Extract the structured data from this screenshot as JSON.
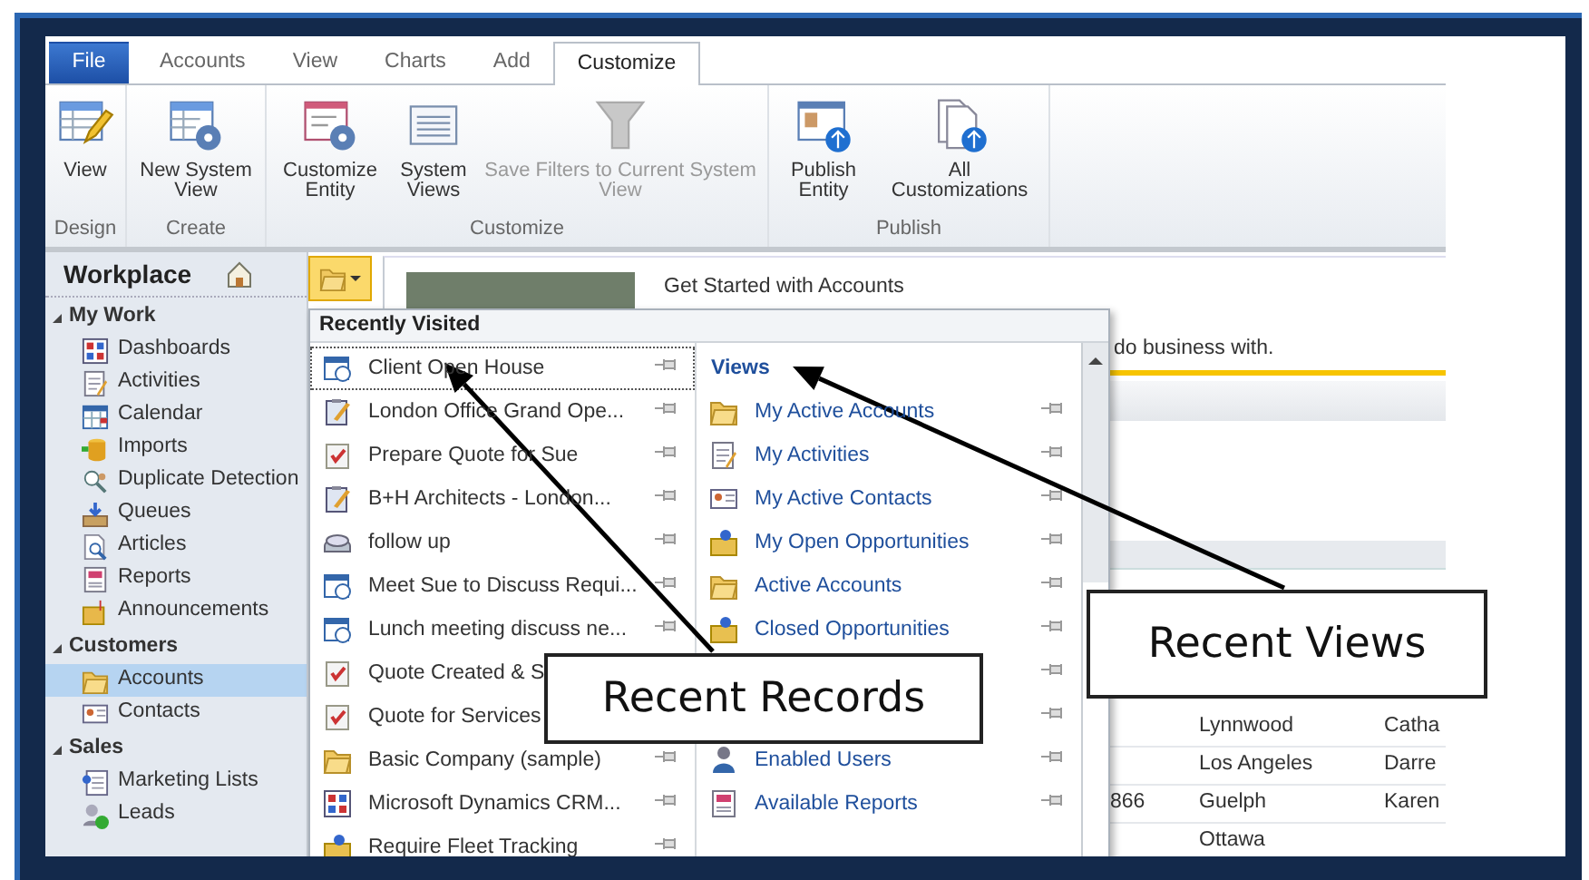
{
  "tabs": [
    {
      "label": "File",
      "kind": "file",
      "selected": false
    },
    {
      "label": "Accounts",
      "kind": "tab",
      "selected": false
    },
    {
      "label": "View",
      "kind": "tab",
      "selected": false
    },
    {
      "label": "Charts",
      "kind": "tab",
      "selected": false
    },
    {
      "label": "Add",
      "kind": "tab",
      "selected": false
    },
    {
      "label": "Customize",
      "kind": "tab",
      "selected": true
    }
  ],
  "ribbon": {
    "groups": [
      {
        "label": "Design",
        "buttons": [
          {
            "label": "View",
            "disabled": false
          }
        ]
      },
      {
        "label": "Create",
        "buttons": [
          {
            "label": "New System View",
            "disabled": false
          }
        ]
      },
      {
        "label": "Customize",
        "buttons": [
          {
            "label": "Customize Entity",
            "disabled": false
          },
          {
            "label": "System Views",
            "disabled": false
          },
          {
            "label": "Save Filters to Current System View",
            "disabled": true
          }
        ]
      },
      {
        "label": "Publish",
        "buttons": [
          {
            "label": "Publish Entity",
            "disabled": false
          },
          {
            "label": "All Customizations",
            "disabled": false
          }
        ]
      }
    ]
  },
  "nav": {
    "title": "Workplace",
    "sections": [
      {
        "label": "My Work",
        "expanded": true,
        "items": [
          {
            "label": "Dashboards",
            "selected": false
          },
          {
            "label": "Activities",
            "selected": false
          },
          {
            "label": "Calendar",
            "selected": false
          },
          {
            "label": "Imports",
            "selected": false
          },
          {
            "label": "Duplicate Detection",
            "selected": false
          },
          {
            "label": "Queues",
            "selected": false
          },
          {
            "label": "Articles",
            "selected": false
          },
          {
            "label": "Reports",
            "selected": false
          },
          {
            "label": "Announcements",
            "selected": false
          }
        ]
      },
      {
        "label": "Customers",
        "expanded": true,
        "items": [
          {
            "label": "Accounts",
            "selected": true
          },
          {
            "label": "Contacts",
            "selected": false
          }
        ]
      },
      {
        "label": "Sales",
        "expanded": true,
        "items": [
          {
            "label": "Marketing Lists",
            "selected": false
          },
          {
            "label": "Leads",
            "selected": false
          }
        ]
      }
    ]
  },
  "content": {
    "title": "Get Started with Accounts",
    "description": "do business with.",
    "grid": {
      "rows": [
        {
          "column_2": "Lynnwood",
          "column_3": "Catha"
        },
        {
          "column_2": "Los Angeles",
          "column_3": "Darre"
        },
        {
          "column_1": "866",
          "column_2": "Guelph",
          "column_3": "Karen"
        },
        {
          "column_2": "Ottawa"
        }
      ]
    }
  },
  "recent_menu": {
    "title": "Recently Visited",
    "records": [
      {
        "label": "Client Open House",
        "focused": true
      },
      {
        "label": "London Office Grand Ope...",
        "focused": false
      },
      {
        "label": "Prepare Quote for Sue",
        "focused": false
      },
      {
        "label": "B+H Architects - London...",
        "focused": false
      },
      {
        "label": "follow up",
        "focused": false
      },
      {
        "label": "Meet Sue to Discuss Requi...",
        "focused": false
      },
      {
        "label": "Lunch meeting discuss ne...",
        "focused": false
      },
      {
        "label": "Quote Created & S",
        "focused": false
      },
      {
        "label": "Quote for Services",
        "focused": false
      },
      {
        "label": "Basic Company (sample)",
        "focused": false
      },
      {
        "label": "Microsoft Dynamics CRM...",
        "focused": false
      },
      {
        "label": "Require Fleet Tracking",
        "focused": false
      }
    ],
    "views_title": "Views",
    "views": [
      {
        "kind": "view",
        "label": "My Active Accounts"
      },
      {
        "kind": "view",
        "label": "My Activities"
      },
      {
        "kind": "view",
        "label": "My Active Contacts"
      },
      {
        "kind": "view",
        "label": "My Open Opportunities"
      },
      {
        "kind": "view",
        "label": "Active Accounts"
      },
      {
        "kind": "view",
        "label": "Closed Opportunities"
      },
      {
        "kind": "covered"
      },
      {
        "kind": "covered"
      },
      {
        "kind": "view",
        "label": "Enabled Users"
      },
      {
        "kind": "view",
        "label": "Available Reports"
      }
    ]
  },
  "callouts": [
    {
      "text": "Recent Records"
    },
    {
      "text": "Recent Views"
    }
  ]
}
